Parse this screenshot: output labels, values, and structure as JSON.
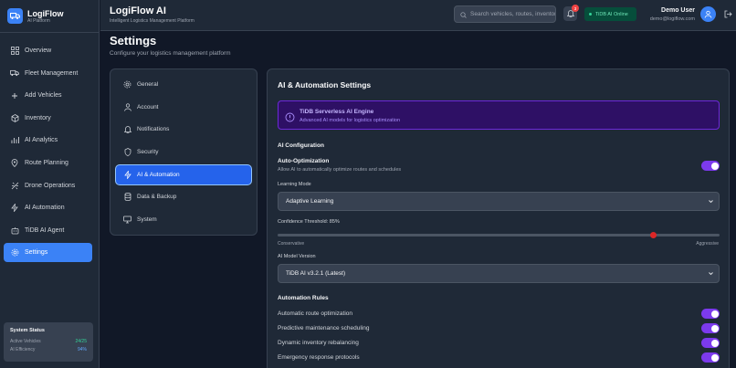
{
  "brand": {
    "name": "LogiFlow",
    "subtitle": "AI Platform"
  },
  "sidebar": {
    "items": [
      {
        "label": "Overview",
        "icon": "grid-icon"
      },
      {
        "label": "Fleet Management",
        "icon": "truck-icon"
      },
      {
        "label": "Add Vehicles",
        "icon": "plus-icon"
      },
      {
        "label": "Inventory",
        "icon": "package-icon"
      },
      {
        "label": "AI Analytics",
        "icon": "analytics-icon"
      },
      {
        "label": "Route Planning",
        "icon": "map-pin-icon"
      },
      {
        "label": "Drone Operations",
        "icon": "drone-icon"
      },
      {
        "label": "AI Automation",
        "icon": "zap-icon"
      },
      {
        "label": "TiDB AI Agent",
        "icon": "bot-icon"
      },
      {
        "label": "Settings",
        "icon": "gear-icon",
        "active": true
      }
    ],
    "system_status": {
      "title": "System Status",
      "rows": [
        {
          "label": "Active Vehicles",
          "value": "24/25"
        },
        {
          "label": "AI Efficiency",
          "value": "94%"
        }
      ]
    }
  },
  "header": {
    "title": "LogiFlow AI",
    "subtitle": "Intelligent Logistics Management Platform",
    "search_placeholder": "Search vehicles, routes, inventory...",
    "notification_count": "3",
    "status": "TiDB AI Online",
    "user_name": "Demo User",
    "user_email": "demo@logiflow.com"
  },
  "page": {
    "title": "Settings",
    "subtitle": "Configure your logistics management platform"
  },
  "settings_nav": {
    "items": [
      {
        "label": "General",
        "icon": "gear-icon"
      },
      {
        "label": "Account",
        "icon": "user-icon"
      },
      {
        "label": "Notifications",
        "icon": "bell-icon"
      },
      {
        "label": "Security",
        "icon": "shield-icon"
      },
      {
        "label": "AI & Automation",
        "icon": "zap-icon",
        "active": true
      },
      {
        "label": "Data & Backup",
        "icon": "database-icon"
      },
      {
        "label": "System",
        "icon": "monitor-icon"
      }
    ]
  },
  "panel": {
    "title": "AI & Automation Settings",
    "callout": {
      "title": "TiDB Serverless AI Engine",
      "subtitle": "Advanced AI models for logistics optimization"
    },
    "ai_config": {
      "heading": "AI Configuration",
      "auto_opt_label": "Auto-Optimization",
      "auto_opt_desc": "Allow AI to automatically optimize routes and schedules",
      "auto_opt_enabled": true,
      "learning_mode_label": "Learning Mode",
      "learning_mode_value": "Adaptive Learning",
      "confidence_label": "Confidence Threshold: 85%",
      "confidence_value": 85,
      "slider_min_label": "Conservative",
      "slider_max_label": "Aggressive",
      "model_version_label": "AI Model Version",
      "model_version_value": "TiDB AI v3.2.1 (Latest)"
    },
    "rules": {
      "heading": "Automation Rules",
      "items": [
        {
          "label": "Automatic route optimization",
          "enabled": true
        },
        {
          "label": "Predictive maintenance scheduling",
          "enabled": true
        },
        {
          "label": "Dynamic inventory rebalancing",
          "enabled": true
        },
        {
          "label": "Emergency response protocols",
          "enabled": true
        }
      ]
    }
  },
  "colors": {
    "accent": "#3b82f6",
    "toggle": "#7c3aed",
    "slider_thumb": "#dc2626",
    "online": "#34d399"
  }
}
